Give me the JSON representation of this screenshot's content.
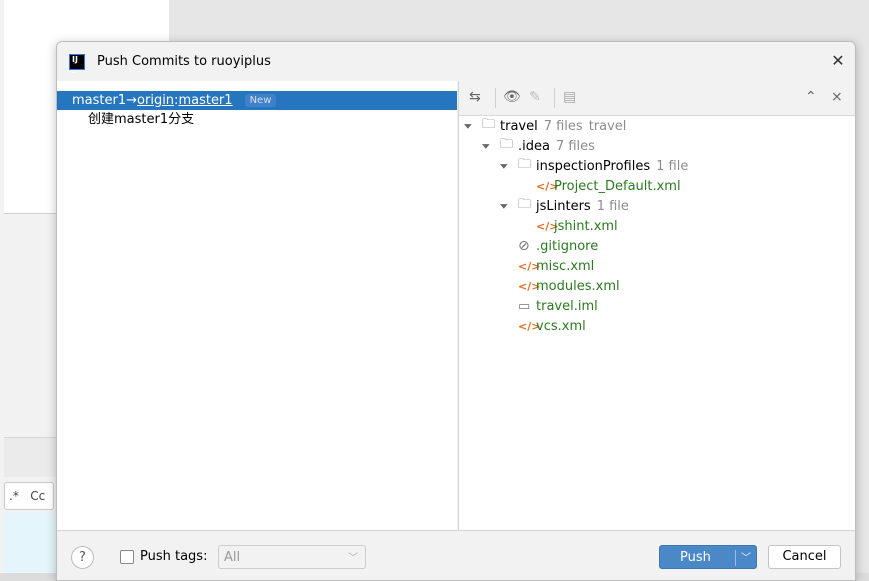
{
  "background": {
    "find_options": ".*   Cc"
  },
  "dialog": {
    "title": "Push Commits to ruoyiplus",
    "logo": "IJ"
  },
  "push_list": {
    "local_branch": "master1",
    "arrow": "→",
    "remote": "origin",
    "colon": ":",
    "remote_branch": "master1",
    "badge": "New",
    "commits": [
      "创建master1分支"
    ]
  },
  "toolbar": {
    "icons": [
      "diff-icon",
      "eye-icon",
      "edit-icon",
      "layout-icon",
      "expand-all-icon",
      "collapse-all-icon"
    ]
  },
  "tree": [
    {
      "name": "travel",
      "count": "7 files",
      "extra": "travel",
      "type": "module",
      "level": 0,
      "expanded": true
    },
    {
      "name": ".idea",
      "count": "7 files",
      "type": "folder",
      "level": 1,
      "expanded": true
    },
    {
      "name": "inspectionProfiles",
      "count": "1 file",
      "type": "folder",
      "level": 2,
      "expanded": true
    },
    {
      "name": "Project_Default.xml",
      "type": "xml",
      "level": 3
    },
    {
      "name": "jsLinters",
      "count": "1 file",
      "type": "folder",
      "level": 2,
      "expanded": true
    },
    {
      "name": "jshint.xml",
      "type": "xml",
      "level": 3
    },
    {
      "name": ".gitignore",
      "type": "ignore",
      "level": 2
    },
    {
      "name": "misc.xml",
      "type": "xml",
      "level": 2
    },
    {
      "name": "modules.xml",
      "type": "xml",
      "level": 2
    },
    {
      "name": "travel.iml",
      "type": "iml",
      "level": 2
    },
    {
      "name": "vcs.xml",
      "type": "xml",
      "level": 2
    }
  ],
  "footer": {
    "help": "?",
    "push_tags_label": "Push tags:",
    "push_tags_checked": false,
    "tags_select": "All",
    "push_label": "Push",
    "cancel_label": "Cancel"
  },
  "colors": {
    "selection": "#2675bf",
    "push_button": "#4a88c7",
    "new_file": "#2a7a1f",
    "xml_icon": "#e06c1d"
  }
}
